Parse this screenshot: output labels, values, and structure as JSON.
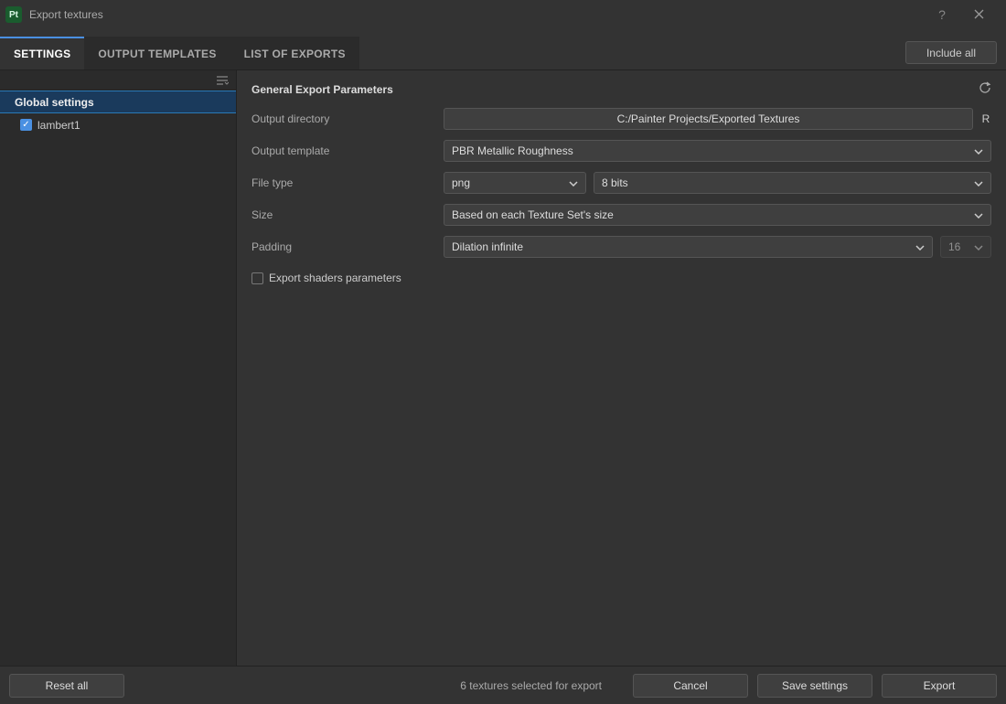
{
  "titlebar": {
    "app_badge": "Pt",
    "title": "Export textures"
  },
  "tabs": {
    "settings": "SETTINGS",
    "output_templates": "OUTPUT TEMPLATES",
    "list_of_exports": "LIST OF EXPORTS"
  },
  "buttons": {
    "include_all": "Include all",
    "reset_all": "Reset all",
    "cancel": "Cancel",
    "save_settings": "Save settings",
    "export": "Export"
  },
  "sidebar": {
    "global": "Global settings",
    "items": [
      {
        "label": "lambert1",
        "checked": true
      }
    ]
  },
  "main": {
    "section_title": "General Export Parameters",
    "labels": {
      "output_directory": "Output directory",
      "output_template": "Output template",
      "file_type": "File type",
      "size": "Size",
      "padding": "Padding",
      "export_shaders": "Export shaders parameters"
    },
    "values": {
      "output_directory": "C:/Painter Projects/Exported Textures",
      "output_directory_suffix": "R",
      "output_template": "PBR Metallic Roughness",
      "file_type": "png",
      "bit_depth": "8 bits",
      "size": "Based on each Texture Set's size",
      "padding": "Dilation infinite",
      "padding_amount": "16",
      "export_shaders_checked": false
    }
  },
  "status": {
    "selected_textures": "6 textures selected for export"
  }
}
